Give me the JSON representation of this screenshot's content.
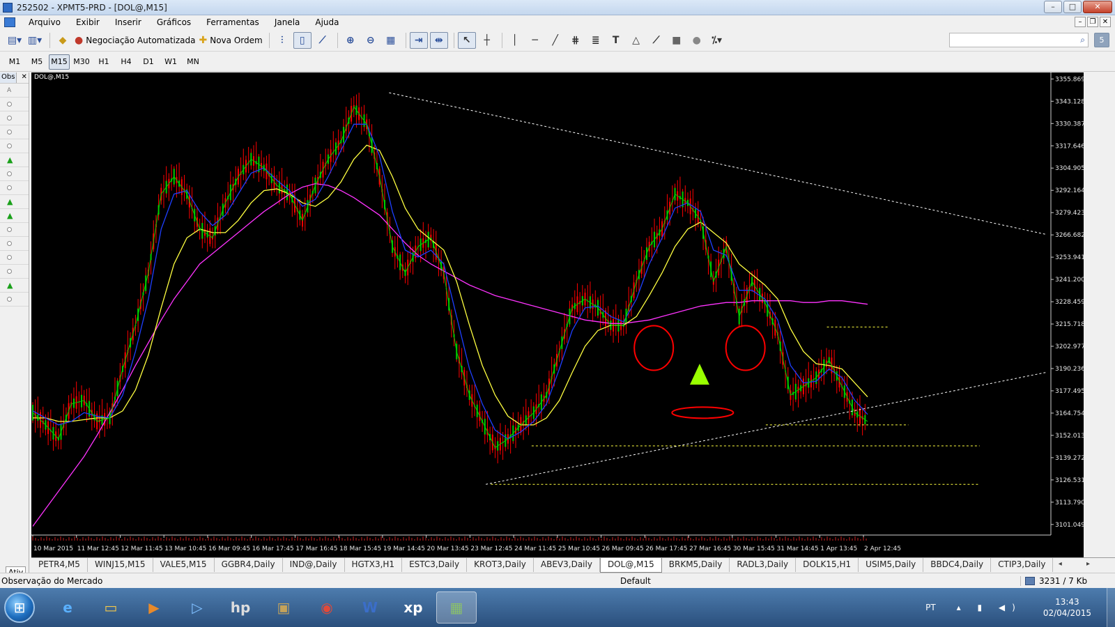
{
  "window": {
    "title": "252502 - XPMT5-PRD - [DOL@,M15]",
    "minimize": "–",
    "maximize": "□",
    "close": "✕"
  },
  "menu": {
    "items": [
      "Arquivo",
      "Exibir",
      "Inserir",
      "Gráficos",
      "Ferramentas",
      "Janela",
      "Ajuda"
    ],
    "mdi_buttons": [
      "–",
      "❐",
      "✕"
    ]
  },
  "toolbar": {
    "auto_trading_label": "Negociação Automatizada",
    "new_order_label": "Nova Ordem",
    "search_placeholder": "",
    "help_label": "5"
  },
  "timeframes": {
    "items": [
      "M1",
      "M5",
      "M15",
      "M30",
      "H1",
      "H4",
      "D1",
      "W1",
      "MN"
    ],
    "active": "M15"
  },
  "side_panel": {
    "tab_label": "Obs",
    "close_label": "✕",
    "bottom_tab": "Ativ",
    "rows": [
      "A",
      "o",
      "o",
      "o",
      "o",
      "▲",
      "o",
      "o",
      "▲",
      "▲",
      "o",
      "o",
      "o",
      "o",
      "▲",
      "o"
    ]
  },
  "chart": {
    "label": "DOL@,M15",
    "colors": {
      "background": "#000000",
      "candles": "#ff0000",
      "ma_green": "#00cc00",
      "ma_blue": "#1e3fff",
      "ma_yellow": "#ffff40",
      "ma_magenta": "#ff33ff",
      "trendline": "#ffffff",
      "support": "#ffff40",
      "annotation_red": "#ff0000",
      "annotation_green": "#99ff00"
    }
  },
  "chart_data": {
    "type": "line",
    "symbol": "DOL@",
    "timeframe": "M15",
    "y_ticks": [
      "3355.869",
      "3343.128",
      "3330.387",
      "3317.646",
      "3304.905",
      "3292.164",
      "3279.423",
      "3266.682",
      "3253.941",
      "3241.200",
      "3228.459",
      "3215.718",
      "3202.977",
      "3190.236",
      "3177.495",
      "3164.754",
      "3152.013",
      "3139.272",
      "3126.531",
      "3113.790",
      "3101.049"
    ],
    "x_ticks": [
      "10 Mar 2015",
      "11 Mar 12:45",
      "12 Mar 11:45",
      "13 Mar 10:45",
      "16 Mar 09:45",
      "16 Mar 17:45",
      "17 Mar 16:45",
      "18 Mar 15:45",
      "19 Mar 14:45",
      "20 Mar 13:45",
      "23 Mar 12:45",
      "24 Mar 11:45",
      "25 Mar 10:45",
      "26 Mar 09:45",
      "26 Mar 17:45",
      "27 Mar 16:45",
      "30 Mar 15:45",
      "31 Mar 14:45",
      "1 Apr 13:45",
      "2 Apr 12:45"
    ],
    "ylim": [
      3095,
      3358
    ],
    "price_series": [
      3165,
      3158,
      3150,
      3170,
      3172,
      3160,
      3162,
      3190,
      3215,
      3245,
      3290,
      3300,
      3290,
      3270,
      3265,
      3285,
      3300,
      3310,
      3305,
      3295,
      3290,
      3275,
      3295,
      3310,
      3320,
      3340,
      3330,
      3300,
      3260,
      3245,
      3260,
      3265,
      3245,
      3200,
      3175,
      3160,
      3145,
      3150,
      3158,
      3165,
      3175,
      3200,
      3225,
      3230,
      3225,
      3215,
      3215,
      3240,
      3260,
      3270,
      3290,
      3285,
      3275,
      3240,
      3260,
      3220,
      3240,
      3228,
      3210,
      3175,
      3180,
      3185,
      3195,
      3180,
      3165,
      3160
    ],
    "ma_fast": [
      3166,
      3162,
      3158,
      3160,
      3165,
      3163,
      3162,
      3175,
      3200,
      3230,
      3270,
      3290,
      3292,
      3280,
      3272,
      3278,
      3290,
      3302,
      3305,
      3298,
      3292,
      3283,
      3287,
      3300,
      3315,
      3330,
      3330,
      3312,
      3280,
      3258,
      3254,
      3258,
      3250,
      3220,
      3190,
      3170,
      3155,
      3150,
      3154,
      3160,
      3170,
      3190,
      3212,
      3225,
      3226,
      3220,
      3217,
      3230,
      3250,
      3265,
      3282,
      3285,
      3280,
      3258,
      3255,
      3235,
      3235,
      3230,
      3218,
      3192,
      3182,
      3183,
      3190,
      3185,
      3172,
      3164
    ],
    "ma_mid": [
      3162,
      3162,
      3160,
      3160,
      3161,
      3162,
      3162,
      3166,
      3178,
      3198,
      3225,
      3250,
      3265,
      3270,
      3268,
      3268,
      3275,
      3285,
      3292,
      3293,
      3290,
      3285,
      3283,
      3288,
      3297,
      3310,
      3318,
      3315,
      3300,
      3282,
      3270,
      3264,
      3258,
      3240,
      3215,
      3192,
      3175,
      3163,
      3158,
      3158,
      3162,
      3172,
      3188,
      3203,
      3212,
      3215,
      3215,
      3220,
      3232,
      3245,
      3260,
      3270,
      3274,
      3268,
      3262,
      3250,
      3244,
      3238,
      3230,
      3213,
      3200,
      3193,
      3192,
      3190,
      3182,
      3174
    ],
    "ma_slow": [
      3100,
      3110,
      3120,
      3130,
      3140,
      3152,
      3165,
      3178,
      3192,
      3205,
      3218,
      3230,
      3240,
      3250,
      3256,
      3262,
      3268,
      3274,
      3280,
      3285,
      3290,
      3294,
      3296,
      3295,
      3292,
      3288,
      3283,
      3278,
      3270,
      3262,
      3255,
      3250,
      3246,
      3242,
      3238,
      3235,
      3232,
      3230,
      3228,
      3226,
      3224,
      3222,
      3220,
      3218,
      3217,
      3216,
      3216,
      3217,
      3218,
      3220,
      3222,
      3224,
      3226,
      3227,
      3228,
      3228,
      3229,
      3229,
      3229,
      3229,
      3228,
      3228,
      3229,
      3229,
      3228,
      3227
    ],
    "annotations": {
      "resistance_trendline": [
        [
          3348,
          0.35
        ],
        [
          3267,
          0.995
        ]
      ],
      "support_trendline": [
        [
          3124,
          0.445
        ],
        [
          3188,
          0.995
        ]
      ],
      "support_levels": [
        3214,
        3158,
        3146,
        3124
      ]
    }
  },
  "tabs": {
    "items": [
      "PETR4,M5",
      "WINJ15,M15",
      "VALE5,M15",
      "GGBR4,Daily",
      "IND@,Daily",
      "HGTX3,H1",
      "ESTC3,Daily",
      "KROT3,Daily",
      "ABEV3,Daily",
      "DOL@,M15",
      "BRKM5,Daily",
      "RADL3,Daily",
      "DOLK15,H1",
      "USIM5,Daily",
      "BBDC4,Daily",
      "CTIP3,Daily"
    ],
    "active": "DOL@,M15",
    "arrows": "◂ ▸"
  },
  "statusbar": {
    "left": "Observação do Mercado",
    "profile": "Default",
    "traffic": "3231 / 7 Kb"
  },
  "taskbar": {
    "start": "⊞",
    "apps": [
      "e",
      "▭",
      "▶",
      "▷",
      "hp",
      "▣",
      "◉",
      "W",
      "xp",
      "▦"
    ],
    "active_index": 9,
    "language": "PT",
    "tray_icons": "▴ ▮ ◀)",
    "time": "13:43",
    "date": "02/04/2015"
  }
}
